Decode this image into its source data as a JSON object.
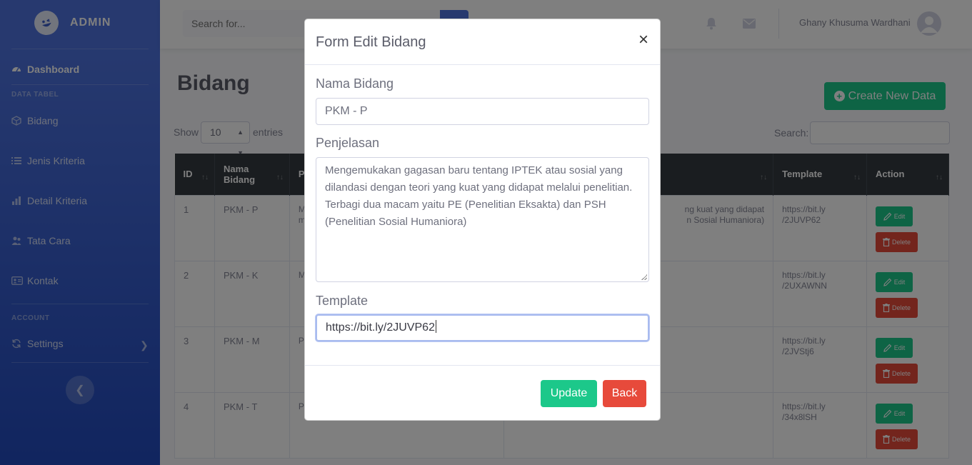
{
  "sidebar": {
    "brand": "ADMIN",
    "dashboard": "Dashboard",
    "heading_data": "DATA TABEL",
    "items": [
      {
        "label": "Bidang"
      },
      {
        "label": "Jenis Kriteria"
      },
      {
        "label": "Detail Kriteria"
      },
      {
        "label": "Tata Cara"
      },
      {
        "label": "Kontak"
      }
    ],
    "heading_account": "ACCOUNT",
    "settings": "Settings",
    "colors": {
      "bg_top": "#4e73df",
      "bg_bottom": "#224abe"
    }
  },
  "topbar": {
    "search_placeholder": "Search for...",
    "username": "Ghany Khusuma Wardhani"
  },
  "page": {
    "title": "Bidang",
    "create_button": "Create New Data",
    "show": "Show",
    "entries_value": "10",
    "entries": "entries",
    "search": "Search:"
  },
  "table": {
    "headers": [
      "ID",
      "Nama Bidang",
      "P",
      "",
      "Template",
      "Action"
    ],
    "rows": [
      {
        "id": "1",
        "nama": "PKM - P",
        "p": "M",
        "p2": "m",
        "desc": "ng kuat yang didapat",
        "desc2": "n Sosial Humaniora)",
        "template": "https://bit.ly",
        "template2": "/2JUVP62"
      },
      {
        "id": "2",
        "nama": "PKM - K",
        "p": "M",
        "p2": "",
        "desc": "",
        "desc2": "",
        "template": "https://bit.ly",
        "template2": "/2UXAWNN"
      },
      {
        "id": "3",
        "nama": "PKM - M",
        "p": "P",
        "p2": "",
        "desc": "",
        "desc2": "",
        "template": "https://bit.ly",
        "template2": "/2JVStj6"
      },
      {
        "id": "4",
        "nama": "PKM - T",
        "p": "P",
        "p2": "",
        "desc": "",
        "desc2": "",
        "template": "https://bit.ly",
        "template2": "/34x8lSH"
      }
    ],
    "edit_label": "Edit",
    "delete_label": "Delete"
  },
  "modal": {
    "title": "Form Edit Bidang",
    "close": "×",
    "nama_label": "Nama Bidang",
    "nama_value": "PKM - P",
    "penjelasan_label": "Penjelasan",
    "penjelasan_value": "Mengemukakan gagasan baru tentang IPTEK atau sosial yang dilandasi dengan teori yang kuat yang didapat melalui penelitian. Terbagi dua macam yaitu PE (Penelitian Eksakta) dan PSH (Penelitian Sosial Humaniora)",
    "template_label": "Template",
    "template_value": "https://bit.ly/2JUVP62",
    "update_button": "Update",
    "back_button": "Back"
  }
}
